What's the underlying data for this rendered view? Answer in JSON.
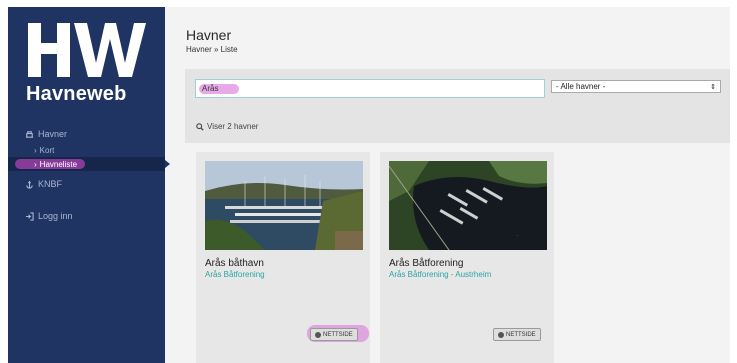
{
  "sidebar": {
    "logo_letters": "HW",
    "logo_text": "Havneweb",
    "items": [
      {
        "label": "Havner",
        "icon": "harbor-icon"
      },
      {
        "label": "Kort",
        "icon": "chevron-right-icon"
      },
      {
        "label": "Havneliste",
        "icon": "chevron-right-icon",
        "active": true
      },
      {
        "label": "KNBF",
        "icon": "anchor-icon"
      },
      {
        "label": "Logg inn",
        "icon": "login-icon"
      }
    ]
  },
  "header": {
    "title": "Havner",
    "breadcrumb": "Havner » Liste"
  },
  "search": {
    "value": "Arås",
    "filter_selected": "- Alle havner -",
    "result_text": "Viser 2 havner"
  },
  "cards": [
    {
      "name": "Arås båthavn",
      "subtitle": "Arås Båtforening",
      "button": "NETTSIDE"
    },
    {
      "name": "Arås Båtforening",
      "subtitle": "Arås Båtforening - Austrheim",
      "button": "NETTSIDE"
    }
  ],
  "colors": {
    "sidebar": "#1f3462",
    "accent_teal": "#2aa5a3",
    "highlight": "#d86fd8"
  }
}
